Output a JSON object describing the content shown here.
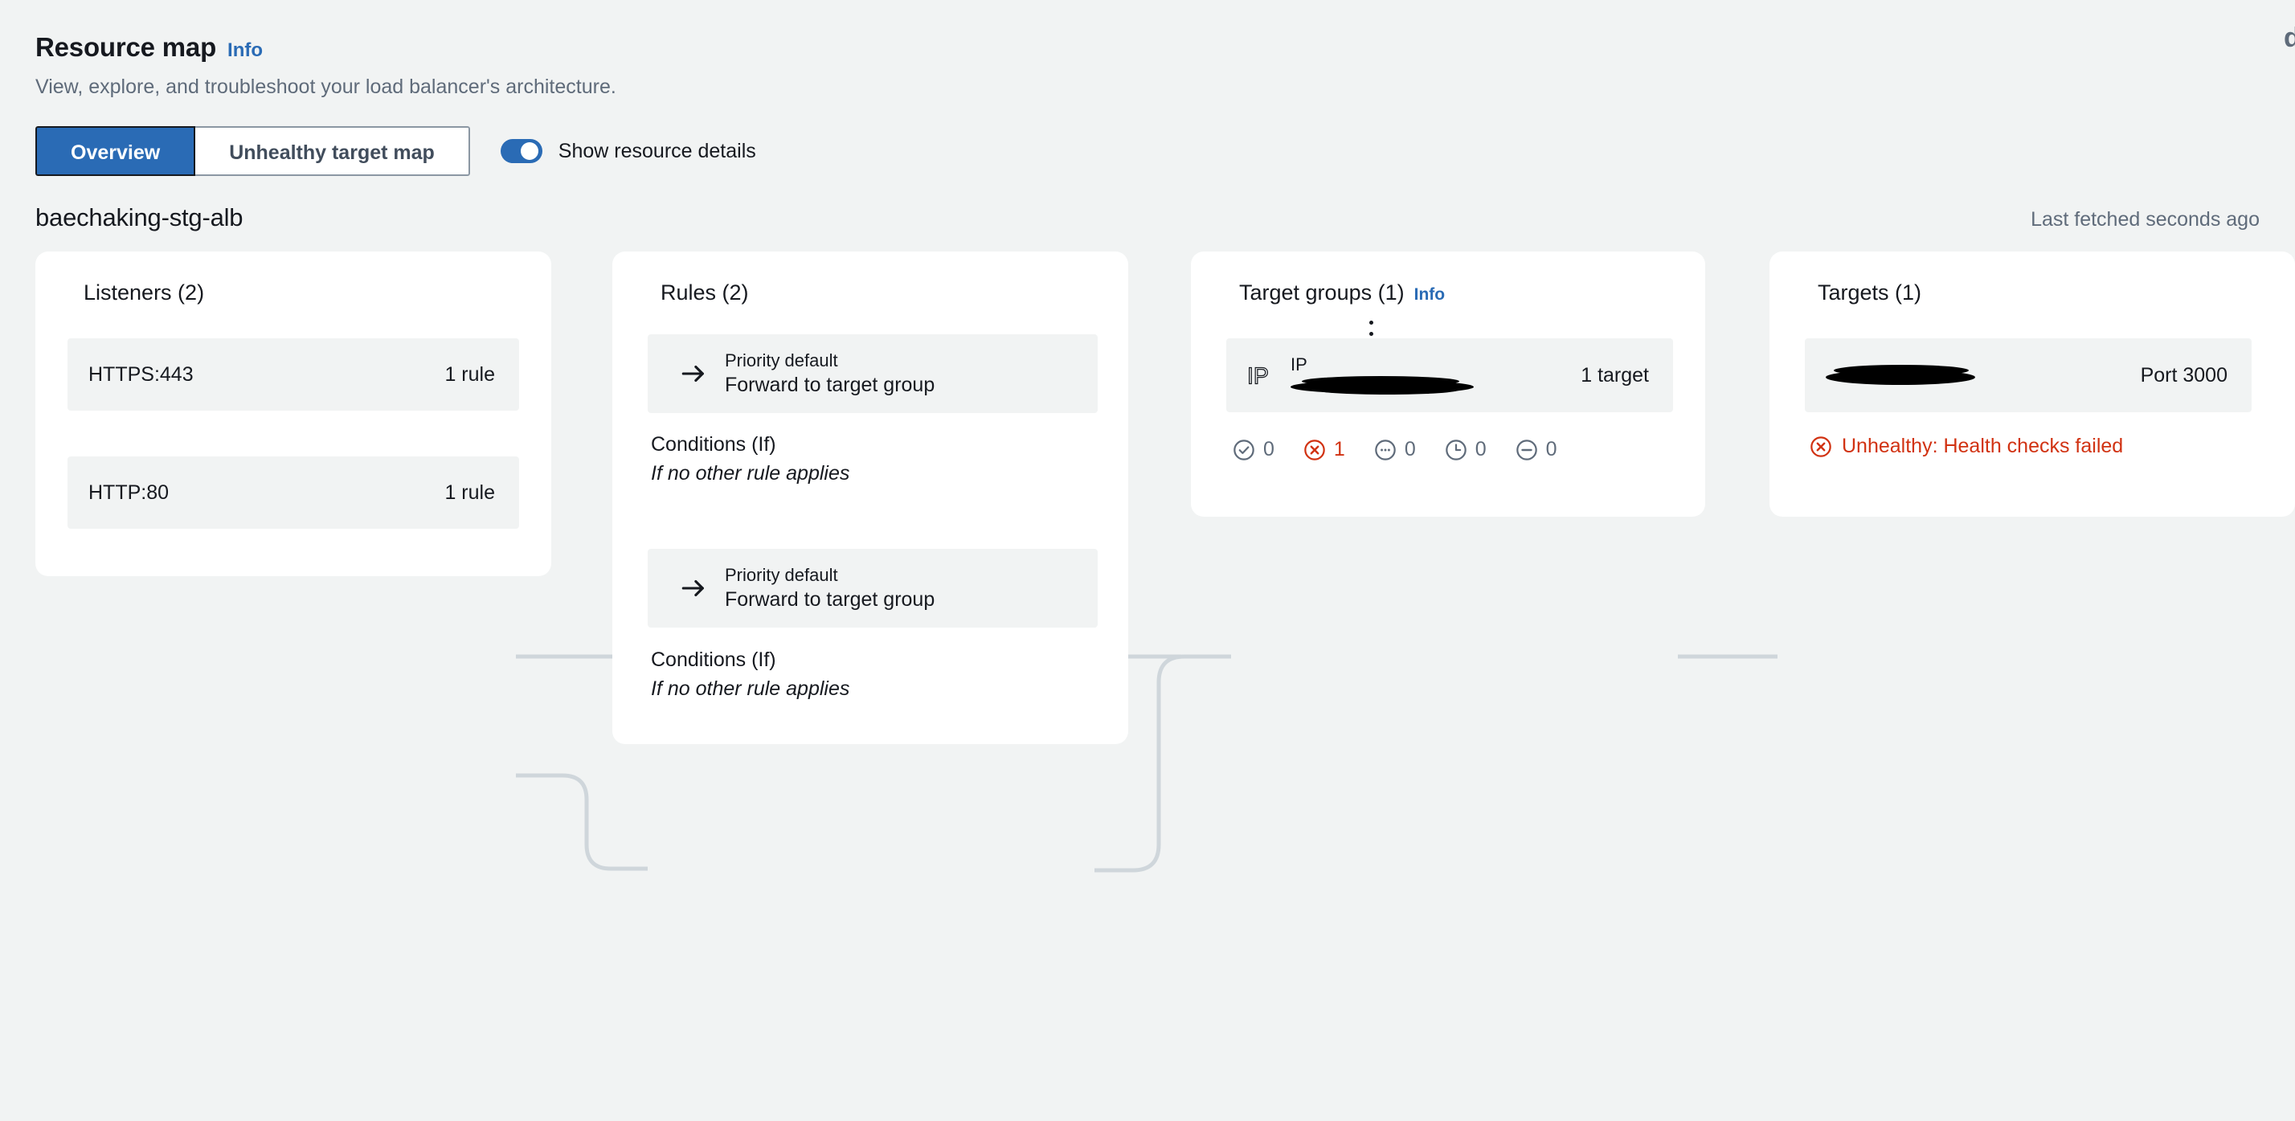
{
  "header": {
    "title": "Resource map",
    "info_label": "Info",
    "subtitle": "View, explore, and troubleshoot your load balancer's architecture."
  },
  "controls": {
    "tabs": [
      {
        "label": "Overview",
        "active": true
      },
      {
        "label": "Unhealthy target map",
        "active": false
      }
    ],
    "toggle": {
      "label": "Show resource details",
      "on": true,
      "accent": "#2a6bb5"
    }
  },
  "resource": {
    "name": "baechaking-stg-alb",
    "last_fetched": "Last fetched seconds ago"
  },
  "columns": {
    "listeners": {
      "title": "Listeners (2)",
      "items": [
        {
          "name": "HTTPS:443",
          "rules": "1 rule"
        },
        {
          "name": "HTTP:80",
          "rules": "1 rule"
        }
      ]
    },
    "rules": {
      "title": "Rules (2)",
      "items": [
        {
          "priority": "Priority default",
          "action": "Forward to target group",
          "conditions_title": "Conditions (If)",
          "conditions_text": "If no other rule applies"
        },
        {
          "priority": "Priority default",
          "action": "Forward to target group",
          "conditions_title": "Conditions (If)",
          "conditions_text": "If no other rule applies"
        }
      ]
    },
    "target_groups": {
      "title": "Target groups (1)",
      "info_label": "Info",
      "items": [
        {
          "type": "IP",
          "name": "",
          "targets": "1 target"
        }
      ],
      "health": [
        {
          "icon": "check-circle-icon",
          "count": "0",
          "state": "healthy"
        },
        {
          "icon": "x-circle-icon",
          "count": "1",
          "state": "unhealthy"
        },
        {
          "icon": "ellipsis-circle-icon",
          "count": "0",
          "state": "unused"
        },
        {
          "icon": "clock-circle-icon",
          "count": "0",
          "state": "initial"
        },
        {
          "icon": "minus-circle-icon",
          "count": "0",
          "state": "draining"
        }
      ]
    },
    "targets": {
      "title": "Targets (1)",
      "items": [
        {
          "name": "",
          "port": "Port 3000",
          "status": "Unhealthy: Health checks failed"
        }
      ]
    }
  },
  "colors": {
    "background": "#f1f3f3",
    "card": "#ffffff",
    "row": "#f1f3f3",
    "accent": "#2a6bb5",
    "danger": "#d13212",
    "muted": "#5f6b7a",
    "connector": "#cfd6db"
  },
  "edge": {
    "glyph": "d"
  }
}
